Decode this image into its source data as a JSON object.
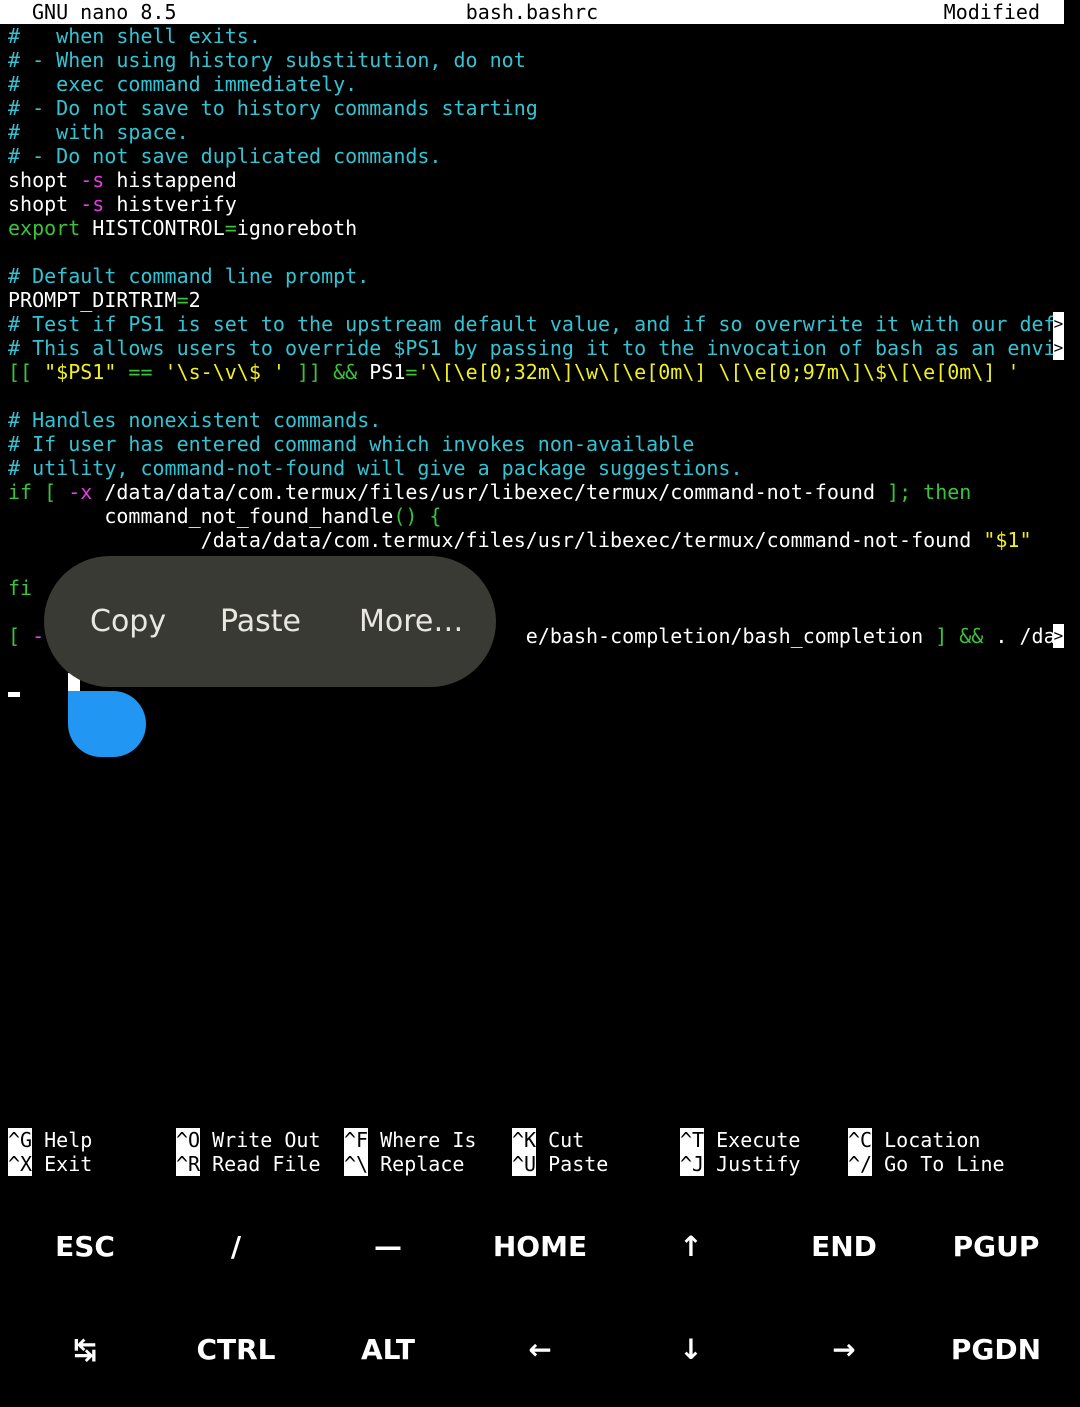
{
  "titlebar": {
    "app": "GNU nano 8.5",
    "file": "bash.bashrc",
    "status": "Modified"
  },
  "editor": {
    "lines": [
      [
        [
          "c",
          "#   when shell exits."
        ]
      ],
      [
        [
          "c",
          "# - When using history substitution, do not"
        ]
      ],
      [
        [
          "c",
          "#   exec command immediately."
        ]
      ],
      [
        [
          "c",
          "# - Do not save to history commands starting"
        ]
      ],
      [
        [
          "c",
          "#   with space."
        ]
      ],
      [
        [
          "c",
          "# - Do not save duplicated commands."
        ]
      ],
      [
        [
          "w",
          "shopt "
        ],
        [
          "m",
          "-s"
        ],
        [
          "w",
          " histappend"
        ]
      ],
      [
        [
          "w",
          "shopt "
        ],
        [
          "m",
          "-s"
        ],
        [
          "w",
          " histverify"
        ]
      ],
      [
        [
          "g",
          "export"
        ],
        [
          "w",
          " HISTCONTROL"
        ],
        [
          "g",
          "="
        ],
        [
          "w",
          "ignoreboth"
        ]
      ],
      [
        [
          "w",
          ""
        ]
      ],
      [
        [
          "c",
          "# Default command line prompt."
        ]
      ],
      [
        [
          "w",
          "PROMPT_DIRTRIM"
        ],
        [
          "g",
          "="
        ],
        [
          "w",
          "2"
        ]
      ],
      [
        [
          "c",
          "# Test if PS1 is set to the upstream default value, and if so overwrite it with our def"
        ]
      ],
      [
        [
          "c",
          "# This allows users to override $PS1 by passing it to the invocation of bash as an envi"
        ]
      ],
      [
        [
          "g",
          "[[ "
        ],
        [
          "y",
          "\"$PS1\""
        ],
        [
          "g",
          " == "
        ],
        [
          "y",
          "'\\s-\\v\\$ '"
        ],
        [
          "g",
          " ]] && "
        ],
        [
          "w",
          "PS1"
        ],
        [
          "g",
          "="
        ],
        [
          "y",
          "'\\[\\e[0;32m\\]\\w\\[\\e[0m\\] \\[\\e[0;97m\\]\\$\\[\\e[0m\\] '"
        ]
      ],
      [
        [
          "w",
          ""
        ]
      ],
      [
        [
          "c",
          "# Handles nonexistent commands."
        ]
      ],
      [
        [
          "c",
          "# If user has entered command which invokes non-available"
        ]
      ],
      [
        [
          "c",
          "# utility, command-not-found will give a package suggestions."
        ]
      ],
      [
        [
          "g",
          "if [ "
        ],
        [
          "m",
          "-x"
        ],
        [
          "w",
          " /data/data/com.termux/files/usr/libexec/termux/command-not-found "
        ],
        [
          "g",
          "]; then"
        ]
      ],
      [
        [
          "w",
          "        command_not_found_handle"
        ],
        [
          "g",
          "() {"
        ]
      ],
      [
        [
          "w",
          "                /data/data/com.termux/files/usr/libexec/termux/command-not-found "
        ],
        [
          "y",
          "\"$1\""
        ]
      ],
      [
        [
          "w",
          ""
        ]
      ],
      [
        [
          "g",
          "fi"
        ]
      ],
      [
        [
          "w",
          ""
        ]
      ],
      [
        [
          "g",
          "[ "
        ],
        [
          "m",
          "-"
        ],
        [
          "w",
          "                                        e/bash-completion/bash_completion "
        ],
        [
          "g",
          "] && "
        ],
        [
          "w",
          ". /data"
        ]
      ]
    ]
  },
  "popup": {
    "copy": "Copy",
    "paste": "Paste",
    "more": "More…"
  },
  "shortcuts": [
    {
      "key": "^G",
      "label": "Help"
    },
    {
      "key": "^X",
      "label": "Exit"
    },
    {
      "key": "^O",
      "label": "Write Out"
    },
    {
      "key": "^R",
      "label": "Read File"
    },
    {
      "key": "^F",
      "label": "Where Is"
    },
    {
      "key": "^\\",
      "label": "Replace"
    },
    {
      "key": "^K",
      "label": "Cut"
    },
    {
      "key": "^U",
      "label": "Paste"
    },
    {
      "key": "^T",
      "label": "Execute"
    },
    {
      "key": "^J",
      "label": "Justify"
    },
    {
      "key": "^C",
      "label": "Location"
    },
    {
      "key": "^/",
      "label": "Go To Line"
    }
  ],
  "extra_keys": {
    "row1": [
      "ESC",
      "/",
      "—",
      "HOME",
      "↑",
      "END",
      "PGUP"
    ],
    "row2": [
      "↹",
      "CTRL",
      "ALT",
      "←",
      "↓",
      "→",
      "PGDN"
    ]
  }
}
